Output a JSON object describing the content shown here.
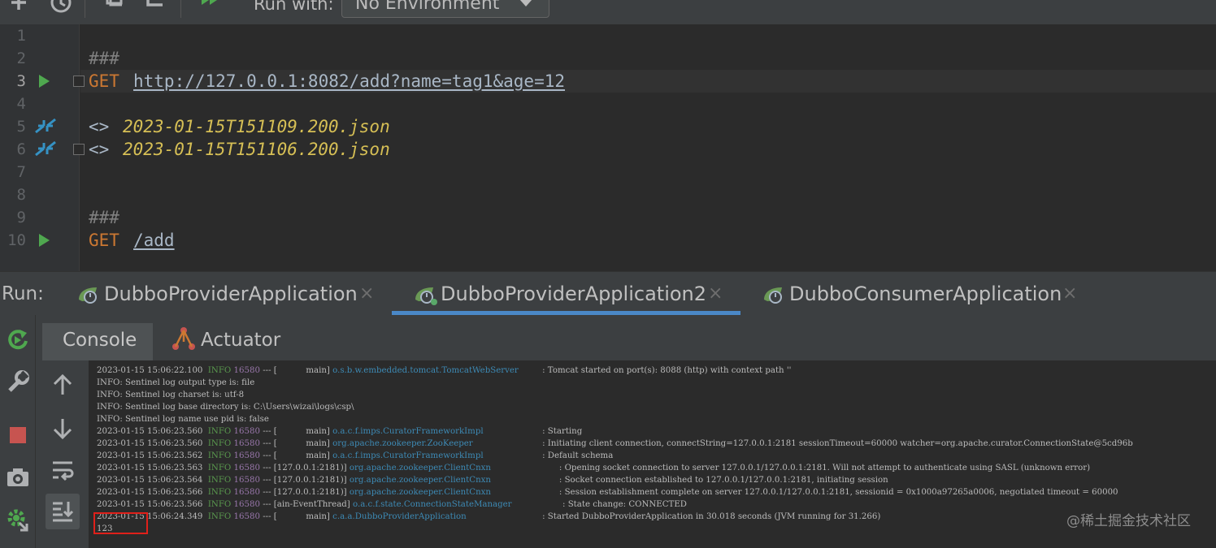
{
  "toolbar": {
    "run_with_label": "Run with:",
    "environment_value": "No Environment"
  },
  "editor": {
    "line_numbers": [
      "1",
      "2",
      "3",
      "4",
      "5",
      "6",
      "7",
      "8",
      "9",
      "10"
    ],
    "lines": {
      "l2_comment": "###",
      "l3_method": "GET",
      "l3_url": "http://127.0.0.1:8082/add?name=tag1&age=12",
      "l5_arrow": "<>",
      "l5_file": "2023-01-15T151109.200.json",
      "l6_arrow": "<>",
      "l6_file": "2023-01-15T151106.200.json",
      "l9_comment": "###",
      "l10_method": "GET",
      "l10_url": "/add"
    }
  },
  "run_panel": {
    "label": "Run:",
    "tabs": [
      {
        "label": "DubboProviderApplication",
        "close": "×"
      },
      {
        "label": "DubboProviderApplication2",
        "close": "×"
      },
      {
        "label": "DubboConsumerApplication",
        "close": "×"
      }
    ],
    "active_tab": 1
  },
  "console_tabs": {
    "console": "Console",
    "actuator": "Actuator"
  },
  "console_log": [
    {
      "ts": "2023-01-15 15:06:22.100",
      "lvl": "INFO",
      "pid": "16580",
      "sep": "---",
      "thread": "[           main]",
      "cls": "o.s.b.w.embedded.tomcat.TomcatWebServer",
      "msg": ": Tomcat started on port(s): 8088 (http) with context path ''"
    },
    {
      "plain": "INFO: Sentinel log output type is: file"
    },
    {
      "plain": "INFO: Sentinel log charset is: utf-8"
    },
    {
      "plain": "INFO: Sentinel log base directory is: C:\\Users\\wizai\\logs\\csp\\"
    },
    {
      "plain": "INFO: Sentinel log name use pid is: false"
    },
    {
      "ts": "2023-01-15 15:06:23.560",
      "lvl": "INFO",
      "pid": "16580",
      "sep": "---",
      "thread": "[           main]",
      "cls": "o.a.c.f.imps.CuratorFrameworkImpl",
      "msg": ": Starting"
    },
    {
      "ts": "2023-01-15 15:06:23.560",
      "lvl": "INFO",
      "pid": "16580",
      "sep": "---",
      "thread": "[           main]",
      "cls": "org.apache.zookeeper.ZooKeeper",
      "msg": ": Initiating client connection, connectString=127.0.0.1:2181 sessionTimeout=60000 watcher=org.apache.curator.ConnectionState@5cd96b"
    },
    {
      "ts": "2023-01-15 15:06:23.562",
      "lvl": "INFO",
      "pid": "16580",
      "sep": "---",
      "thread": "[           main]",
      "cls": "o.a.c.f.imps.CuratorFrameworkImpl",
      "msg": ": Default schema"
    },
    {
      "ts": "2023-01-15 15:06:23.563",
      "lvl": "INFO",
      "pid": "16580",
      "sep": "---",
      "thread": "[127.0.0.1:2181)]",
      "cls": "org.apache.zookeeper.ClientCnxn",
      "msg": ": Opening socket connection to server 127.0.0.1/127.0.0.1:2181. Will not attempt to authenticate using SASL (unknown error)"
    },
    {
      "ts": "2023-01-15 15:06:23.564",
      "lvl": "INFO",
      "pid": "16580",
      "sep": "---",
      "thread": "[127.0.0.1:2181)]",
      "cls": "org.apache.zookeeper.ClientCnxn",
      "msg": ": Socket connection established to 127.0.0.1/127.0.0.1:2181, initiating session"
    },
    {
      "ts": "2023-01-15 15:06:23.566",
      "lvl": "INFO",
      "pid": "16580",
      "sep": "---",
      "thread": "[127.0.0.1:2181)]",
      "cls": "org.apache.zookeeper.ClientCnxn",
      "msg": ": Session establishment complete on server 127.0.0.1/127.0.0.1:2181, sessionid = 0x1000a97265a0006, negotiated timeout = 60000"
    },
    {
      "ts": "2023-01-15 15:06:23.566",
      "lvl": "INFO",
      "pid": "16580",
      "sep": "---",
      "thread": "[ain-EventThread]",
      "cls": "o.a.c.f.state.ConnectionStateManager",
      "msg": ": State change: CONNECTED"
    },
    {
      "ts": "2023-01-15 15:06:24.349",
      "lvl": "INFO",
      "pid": "16580",
      "sep": "---",
      "thread": "[           main]",
      "cls": "c.a.a.DubboProviderApplication",
      "msg": ": Started DubboProviderApplication in 30.018 seconds (JVM running for 31.266)"
    },
    {
      "plain": "123"
    }
  ],
  "watermark": "@稀土掘金技术社区",
  "colors": {
    "accent_tab_underline": "#4a88c7",
    "highlight_box": "#e0201a",
    "run_green": "#4fa84f",
    "stop_red": "#c75450"
  }
}
